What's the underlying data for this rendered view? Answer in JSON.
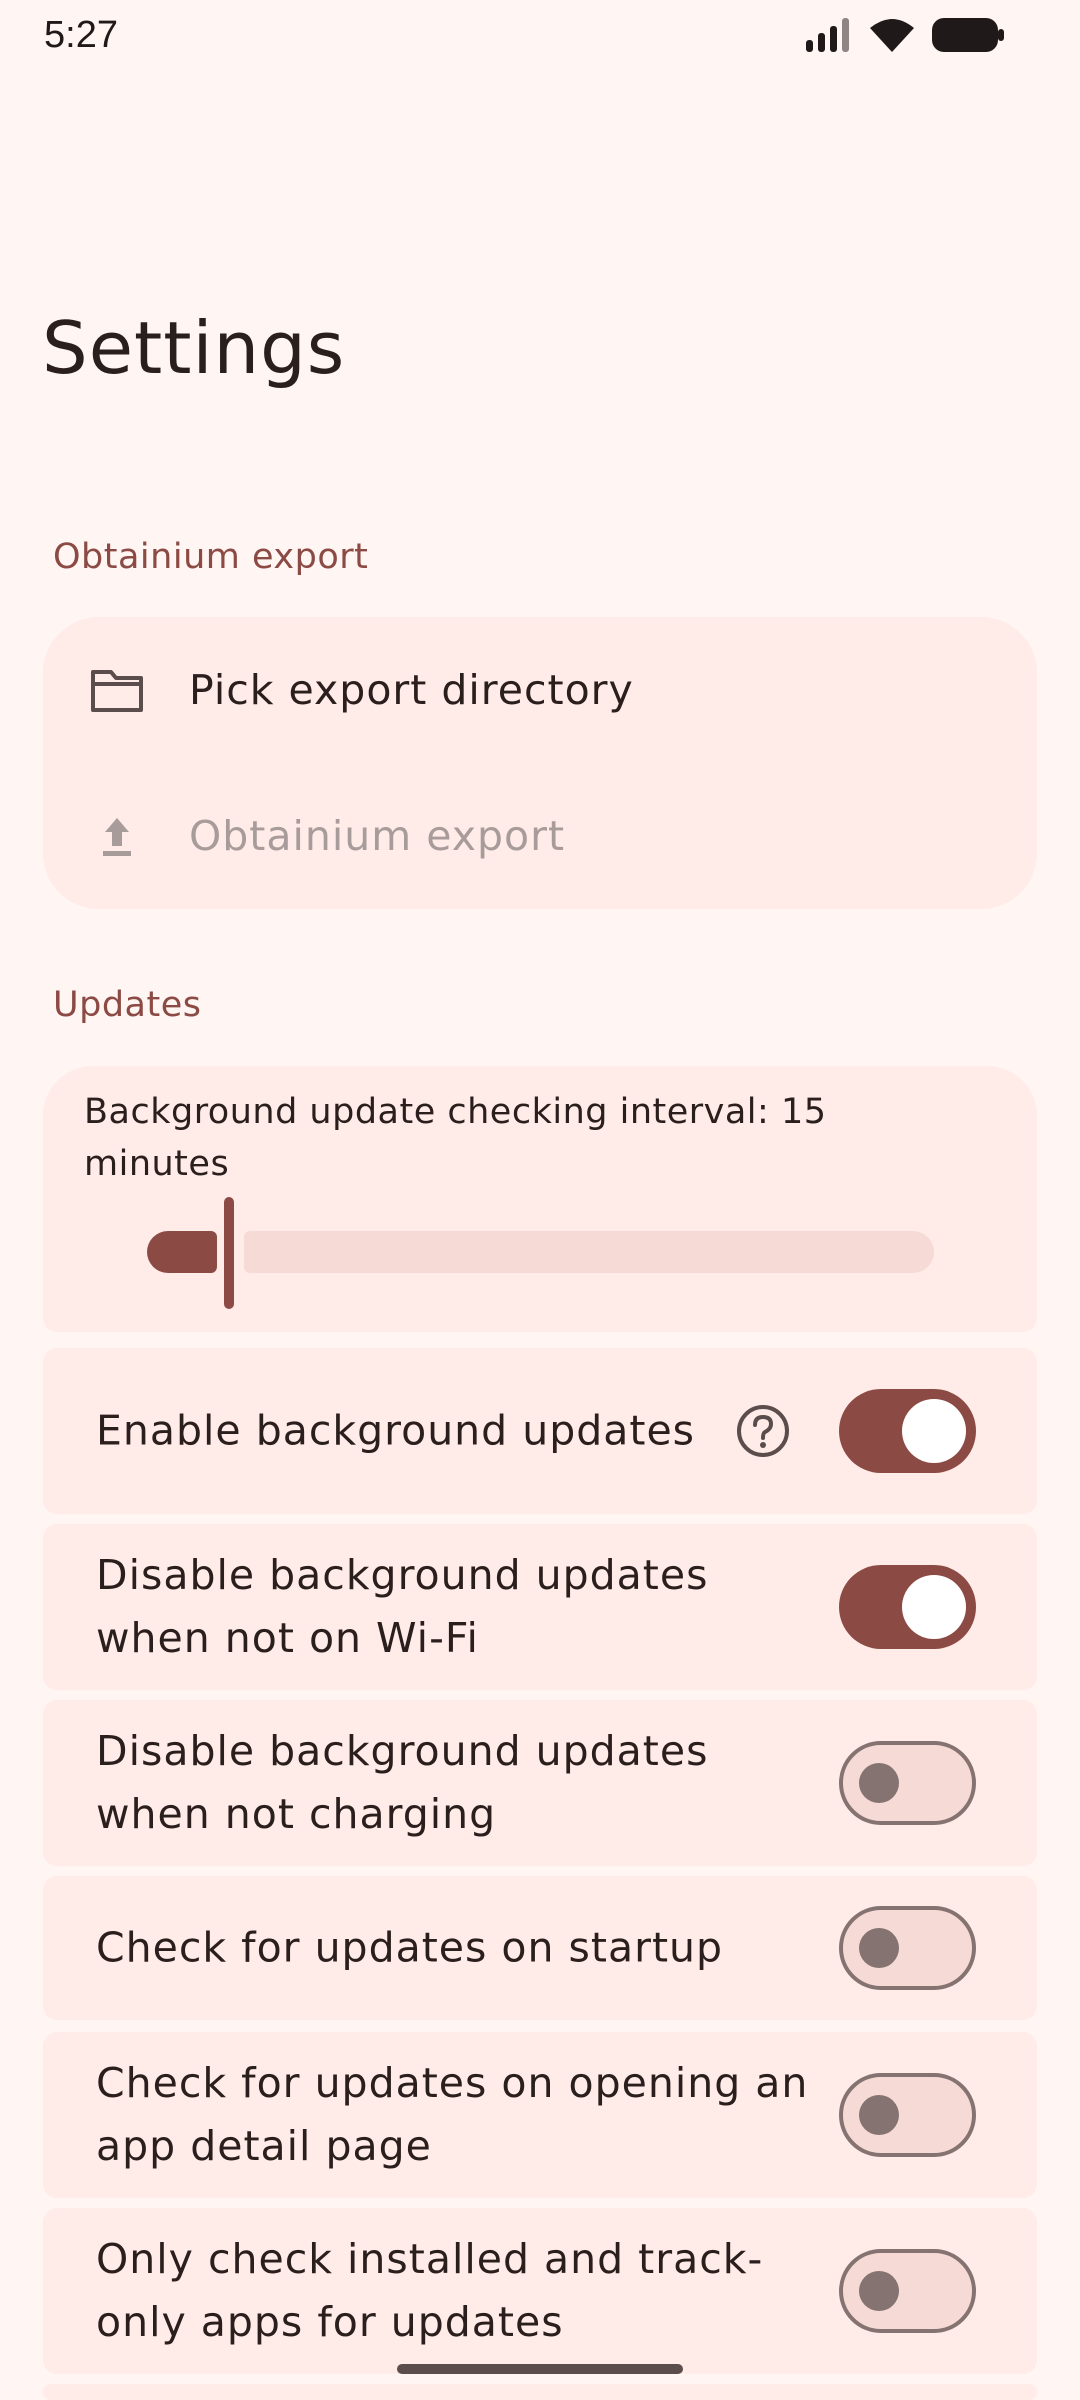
{
  "status_bar": {
    "time": "5:27",
    "icons": [
      "signal-icon",
      "wifi-icon",
      "battery-icon"
    ]
  },
  "page": {
    "title": "Settings"
  },
  "sections": {
    "export": {
      "header": "Obtainium export",
      "items": [
        {
          "label": "Pick export directory",
          "icon": "folder-icon",
          "enabled": true
        },
        {
          "label": "Obtainium export",
          "icon": "upload-icon",
          "enabled": false
        }
      ]
    },
    "updates": {
      "header": "Updates",
      "interval": {
        "label": "Background update checking interval: 15 minutes",
        "value_minutes": 15,
        "slider_fraction": 0.08
      },
      "toggles": [
        {
          "label": "Enable background updates",
          "on": true,
          "help_icon": true
        },
        {
          "label": "Disable background updates when not on Wi-Fi",
          "on": true
        },
        {
          "label": "Disable background updates when not charging",
          "on": false
        },
        {
          "label": "Check for updates on startup",
          "on": false
        },
        {
          "label": "Check for updates on opening an app detail page",
          "on": false
        },
        {
          "label": "Only check installed and track-only apps for updates",
          "on": false
        }
      ]
    }
  },
  "colors": {
    "background": "#FFF5F3",
    "card": "#FFEBE8",
    "accent": "#8C4A44",
    "track_inactive": "#F6DAD6",
    "outline": "#857371"
  }
}
